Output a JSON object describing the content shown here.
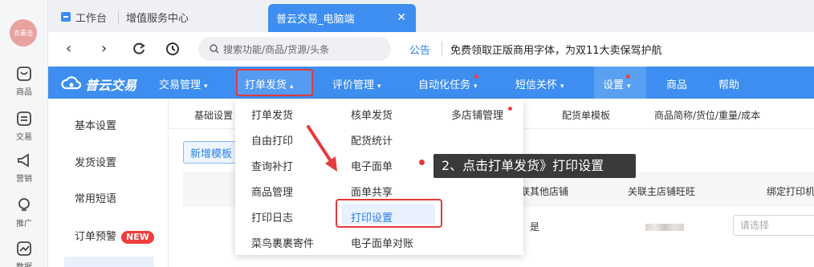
{
  "rail": {
    "avatar_text": "衣素佳",
    "items": [
      {
        "label": "商品",
        "icon": "product-icon"
      },
      {
        "label": "交易",
        "icon": "trade-icon"
      },
      {
        "label": "营销",
        "icon": "marketing-icon"
      },
      {
        "label": "推广",
        "icon": "promotion-icon"
      },
      {
        "label": "数据",
        "icon": "data-icon"
      }
    ]
  },
  "tabs": {
    "workbench": "工作台",
    "value_added": "增值服务中心",
    "active": "普云交易_电脑端"
  },
  "toolbar": {
    "search_placeholder": "搜索功能/商品/货源/头条",
    "notice_label": "公告",
    "notice_text": "免费领取正版商用字体，为双11大卖保驾护航"
  },
  "mainnav": {
    "logo": "普云交易",
    "items": [
      "交易管理",
      "打单发货",
      "评价管理",
      "自动化任务",
      "短信关怀",
      "设置",
      "商品",
      "帮助"
    ]
  },
  "sidebar": {
    "items": [
      "基本设置",
      "发货设置",
      "常用短语",
      "订单预警"
    ],
    "badge": "NEW"
  },
  "subtabs": [
    "基础设置",
    "配货单模板",
    "商品简称/货位/重量/成本"
  ],
  "buttons": {
    "new_template": "新增模板"
  },
  "table": {
    "headers": [
      "联其他店铺",
      "关联主店铺旺旺",
      "绑定打印机"
    ],
    "row_value": "是",
    "select_placeholder": "请选择"
  },
  "dropdown": {
    "col1": [
      "打单发货",
      "自由打印",
      "查询补打",
      "商品管理",
      "打印日志",
      "菜鸟裹裹寄件"
    ],
    "col2": [
      "核单发货",
      "配货统计",
      "电子面单",
      "面单共享",
      "打印设置",
      "电子面单对账"
    ],
    "col3": [
      "多店铺管理"
    ]
  },
  "annotation": {
    "text": "2、点击打单发货》打印设置"
  },
  "colors": {
    "primary": "#3d8ef0",
    "highlight": "#e53a3a",
    "dot": "#ff3b3b"
  }
}
